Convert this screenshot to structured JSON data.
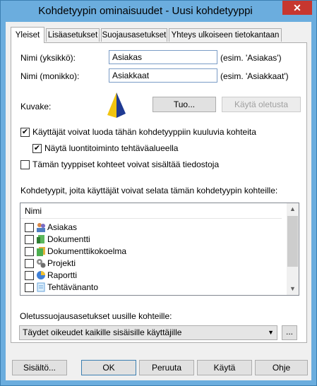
{
  "window": {
    "title": "Kohdetyypin ominaisuudet - Uusi kohdetyyppi",
    "close_label": "✕"
  },
  "tabs": [
    {
      "label": "Yleiset"
    },
    {
      "label": "Lisäasetukset"
    },
    {
      "label": "Suojausasetukset"
    },
    {
      "label": "Yhteys ulkoiseen tietokantaan"
    }
  ],
  "general": {
    "name_singular_label": "Nimi (yksikkö):",
    "name_singular_value": "Asiakas",
    "name_singular_hint": "(esim. 'Asiakas')",
    "name_plural_label": "Nimi (monikko):",
    "name_plural_value": "Asiakkaat",
    "name_plural_hint": "(esim. 'Asiakkaat')",
    "icon_label": "Kuvake:",
    "import_button": "Tuo...",
    "use_default_button": "Käytä oletusta",
    "checkbox_create": {
      "label": "Käyttäjät voivat luoda tähän kohdetyyppiin kuuluvia kohteita",
      "checked": true
    },
    "checkbox_show_task": {
      "label": "Näytä luontitoiminto tehtäväalueella",
      "checked": true
    },
    "checkbox_files": {
      "label": "Tämän tyyppiset kohteet voivat sisältää tiedostoja",
      "checked": false
    },
    "browse_label": "Kohdetyypit, joita käyttäjät voivat selata tämän kohdetyypin kohteille:",
    "list_header": "Nimi",
    "list_items": [
      {
        "name": "Asiakas",
        "icon": "customer-icon",
        "checked": false
      },
      {
        "name": "Dokumentti",
        "icon": "document-icon",
        "checked": false
      },
      {
        "name": "Dokumenttikokoelma",
        "icon": "document-collection-icon",
        "checked": false
      },
      {
        "name": "Projekti",
        "icon": "project-icon",
        "checked": false
      },
      {
        "name": "Raportti",
        "icon": "report-icon",
        "checked": false
      },
      {
        "name": "Tehtävänanto",
        "icon": "assignment-icon",
        "checked": false
      }
    ],
    "security_label": "Oletussuojausasetukset uusille kohteille:",
    "security_value": "Täydet oikeudet kaikille sisäisille käyttäjille",
    "security_more_button": "..."
  },
  "footer": {
    "contents_button": "Sisältö...",
    "ok_button": "OK",
    "cancel_button": "Peruuta",
    "apply_button": "Käytä",
    "help_button": "Ohje"
  },
  "colors": {
    "titlebar": "#6badde",
    "close": "#c7372f",
    "face": "#f0f0f0"
  }
}
